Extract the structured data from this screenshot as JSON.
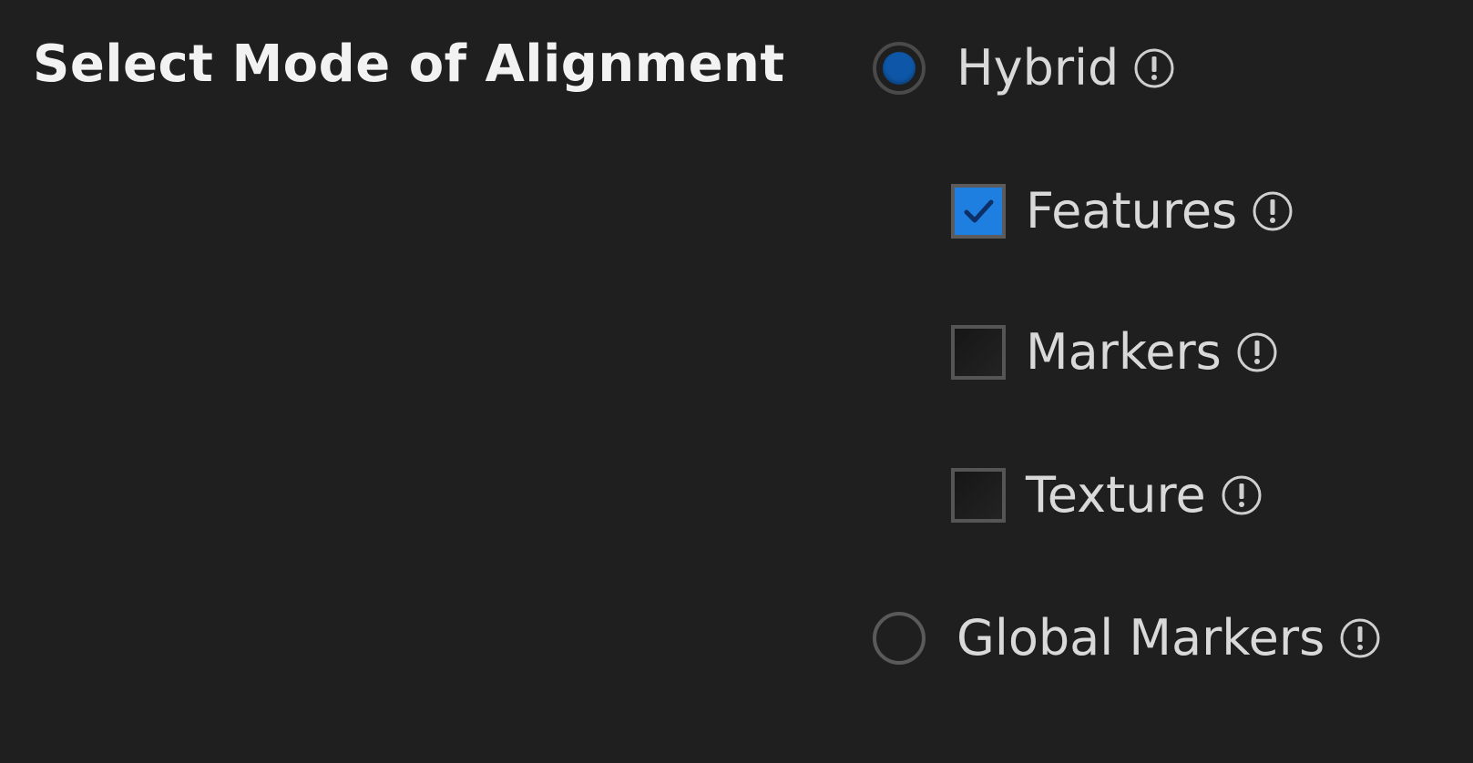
{
  "section": {
    "title": "Select Mode of Alignment"
  },
  "options": {
    "hybrid": {
      "label": "Hybrid",
      "checked": true
    },
    "features": {
      "label": "Features",
      "checked": true
    },
    "markers": {
      "label": "Markers",
      "checked": false
    },
    "texture": {
      "label": "Texture",
      "checked": false
    },
    "global_markers": {
      "label": "Global Markers",
      "checked": false
    }
  },
  "icons": {
    "info": "info-circle-icon",
    "check": "checkmark-icon"
  },
  "colors": {
    "radio_selected": "#0e57a8",
    "checkbox_checked": "#1f7fe0",
    "background": "#1f1f1f",
    "text": "#d9d9d9"
  }
}
